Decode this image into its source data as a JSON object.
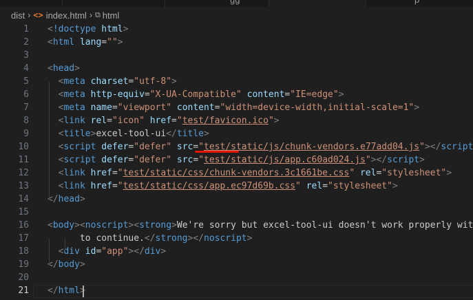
{
  "breadcrumb": {
    "folder": "dist",
    "file": "index.html",
    "symbol": "html",
    "file_icon": "html-file-icon",
    "symbol_icon": "tag-symbol-icon",
    "separator_icon": "chevron-right-icon"
  },
  "tabs": [
    {
      "label": ""
    },
    {
      "label": "gg"
    },
    {
      "label": ""
    },
    {
      "label": "p"
    }
  ],
  "current_line": 21,
  "colors": {
    "tag": "#569cd6",
    "attribute": "#9cdcfe",
    "value": "#ce9178",
    "punctuation": "#808080",
    "text": "#cccccc",
    "error_squiggle": "#e51400"
  },
  "lines": [
    {
      "n": "1",
      "parts": [
        [
          "t",
          "<"
        ],
        [
          "tn",
          "!doctype"
        ],
        [
          "tx",
          " "
        ],
        [
          "an",
          "html"
        ],
        [
          "t",
          ">"
        ]
      ]
    },
    {
      "n": "2",
      "parts": [
        [
          "t",
          "<"
        ],
        [
          "tn",
          "html"
        ],
        [
          "tx",
          " "
        ],
        [
          "an",
          "lang"
        ],
        [
          "eq",
          "="
        ],
        [
          "av",
          "\"\""
        ],
        [
          "t",
          ">"
        ]
      ]
    },
    {
      "n": "3",
      "parts": []
    },
    {
      "n": "4",
      "parts": [
        [
          "t",
          "<"
        ],
        [
          "tn",
          "head"
        ],
        [
          "t",
          ">"
        ]
      ]
    },
    {
      "n": "5",
      "parts": [
        [
          "tx",
          "  "
        ],
        [
          "t",
          "<"
        ],
        [
          "tn",
          "meta"
        ],
        [
          "tx",
          " "
        ],
        [
          "an",
          "charset"
        ],
        [
          "eq",
          "="
        ],
        [
          "av",
          "\"utf-8\""
        ],
        [
          "t",
          ">"
        ]
      ]
    },
    {
      "n": "6",
      "parts": [
        [
          "tx",
          "  "
        ],
        [
          "t",
          "<"
        ],
        [
          "tn",
          "meta"
        ],
        [
          "tx",
          " "
        ],
        [
          "an",
          "http-equiv"
        ],
        [
          "eq",
          "="
        ],
        [
          "av",
          "\"X-UA-Compatible\""
        ],
        [
          "tx",
          " "
        ],
        [
          "an",
          "content"
        ],
        [
          "eq",
          "="
        ],
        [
          "av",
          "\"IE=edge\""
        ],
        [
          "t",
          ">"
        ]
      ]
    },
    {
      "n": "7",
      "parts": [
        [
          "tx",
          "  "
        ],
        [
          "t",
          "<"
        ],
        [
          "tn",
          "meta"
        ],
        [
          "tx",
          " "
        ],
        [
          "an",
          "name"
        ],
        [
          "eq",
          "="
        ],
        [
          "av",
          "\"viewport\""
        ],
        [
          "tx",
          " "
        ],
        [
          "an",
          "content"
        ],
        [
          "eq",
          "="
        ],
        [
          "av",
          "\"width=device-width,initial-scale=1\""
        ],
        [
          "t",
          ">"
        ]
      ]
    },
    {
      "n": "8",
      "parts": [
        [
          "tx",
          "  "
        ],
        [
          "t",
          "<"
        ],
        [
          "tn",
          "link"
        ],
        [
          "tx",
          " "
        ],
        [
          "an",
          "rel"
        ],
        [
          "eq",
          "="
        ],
        [
          "av",
          "\"icon\""
        ],
        [
          "tx",
          " "
        ],
        [
          "an",
          "href"
        ],
        [
          "eq",
          "="
        ],
        [
          "av",
          "\""
        ],
        [
          "av-link",
          "test/favicon.ico"
        ],
        [
          "av",
          "\""
        ],
        [
          "t",
          ">"
        ]
      ]
    },
    {
      "n": "9",
      "parts": [
        [
          "tx",
          "  "
        ],
        [
          "t",
          "<"
        ],
        [
          "tn",
          "title"
        ],
        [
          "t",
          ">"
        ],
        [
          "tx",
          "excel-tool-ui"
        ],
        [
          "t",
          "</"
        ],
        [
          "tn",
          "title"
        ],
        [
          "t",
          ">"
        ]
      ]
    },
    {
      "n": "10",
      "parts": [
        [
          "tx",
          "  "
        ],
        [
          "t",
          "<"
        ],
        [
          "tn",
          "script"
        ],
        [
          "tx",
          " "
        ],
        [
          "an",
          "defer"
        ],
        [
          "eq",
          "="
        ],
        [
          "av",
          "\"defer\""
        ],
        [
          "tx",
          " "
        ],
        [
          "an",
          "src"
        ],
        [
          "eq",
          "="
        ],
        [
          "av",
          "\""
        ],
        [
          "av-link",
          "test/static/js/chunk-vendors.e77add04.js"
        ],
        [
          "av",
          "\""
        ],
        [
          "t",
          "></"
        ],
        [
          "tn",
          "script"
        ],
        [
          "t",
          ">"
        ]
      ]
    },
    {
      "n": "11",
      "parts": [
        [
          "tx",
          "  "
        ],
        [
          "t",
          "<"
        ],
        [
          "tn",
          "script"
        ],
        [
          "tx",
          " "
        ],
        [
          "an",
          "defer"
        ],
        [
          "eq",
          "="
        ],
        [
          "av",
          "\"defer\""
        ],
        [
          "tx",
          " "
        ],
        [
          "an",
          "src"
        ],
        [
          "eq",
          "="
        ],
        [
          "av",
          "\""
        ],
        [
          "av-link",
          "test/static/js/app.c60ad024.js"
        ],
        [
          "av",
          "\""
        ],
        [
          "t",
          "></"
        ],
        [
          "tn",
          "script"
        ],
        [
          "t",
          ">"
        ]
      ]
    },
    {
      "n": "12",
      "parts": [
        [
          "tx",
          "  "
        ],
        [
          "t",
          "<"
        ],
        [
          "tn",
          "link"
        ],
        [
          "tx",
          " "
        ],
        [
          "an",
          "href"
        ],
        [
          "eq",
          "="
        ],
        [
          "av",
          "\""
        ],
        [
          "av-link",
          "test/static/css/chunk-vendors.3c1661be.css"
        ],
        [
          "av",
          "\""
        ],
        [
          "tx",
          " "
        ],
        [
          "an",
          "rel"
        ],
        [
          "eq",
          "="
        ],
        [
          "av",
          "\"stylesheet\""
        ],
        [
          "t",
          ">"
        ]
      ]
    },
    {
      "n": "13",
      "parts": [
        [
          "tx",
          "  "
        ],
        [
          "t",
          "<"
        ],
        [
          "tn",
          "link"
        ],
        [
          "tx",
          " "
        ],
        [
          "an",
          "href"
        ],
        [
          "eq",
          "="
        ],
        [
          "av",
          "\""
        ],
        [
          "av-link",
          "test/static/css/app.ec97d69b.css"
        ],
        [
          "av",
          "\""
        ],
        [
          "tx",
          " "
        ],
        [
          "an",
          "rel"
        ],
        [
          "eq",
          "="
        ],
        [
          "av",
          "\"stylesheet\""
        ],
        [
          "t",
          ">"
        ]
      ]
    },
    {
      "n": "14",
      "parts": [
        [
          "t",
          "</"
        ],
        [
          "tn",
          "head"
        ],
        [
          "t",
          ">"
        ]
      ]
    },
    {
      "n": "15",
      "parts": []
    },
    {
      "n": "16",
      "parts": [
        [
          "t",
          "<"
        ],
        [
          "tn",
          "body"
        ],
        [
          "t",
          "><"
        ],
        [
          "tn",
          "noscript"
        ],
        [
          "t",
          "><"
        ],
        [
          "tn",
          "strong"
        ],
        [
          "t",
          ">"
        ],
        [
          "tx",
          "We're sorry but excel-tool-ui doesn't work properly witho"
        ]
      ]
    },
    {
      "n": "17",
      "parts": [
        [
          "tx",
          "      to continue."
        ],
        [
          "t",
          "</"
        ],
        [
          "tn",
          "strong"
        ],
        [
          "t",
          "></"
        ],
        [
          "tn",
          "noscript"
        ],
        [
          "t",
          ">"
        ]
      ]
    },
    {
      "n": "18",
      "parts": [
        [
          "tx",
          "  "
        ],
        [
          "t",
          "<"
        ],
        [
          "tn",
          "div"
        ],
        [
          "tx",
          " "
        ],
        [
          "an",
          "id"
        ],
        [
          "eq",
          "="
        ],
        [
          "av",
          "\"app\""
        ],
        [
          "t",
          "></"
        ],
        [
          "tn",
          "div"
        ],
        [
          "t",
          ">"
        ]
      ]
    },
    {
      "n": "19",
      "parts": [
        [
          "t",
          "</"
        ],
        [
          "tn",
          "body"
        ],
        [
          "t",
          ">"
        ]
      ]
    },
    {
      "n": "20",
      "parts": []
    },
    {
      "n": "21",
      "parts": [
        [
          "t",
          "</"
        ],
        [
          "tn",
          "html"
        ],
        [
          "t",
          ">"
        ]
      ]
    }
  ]
}
